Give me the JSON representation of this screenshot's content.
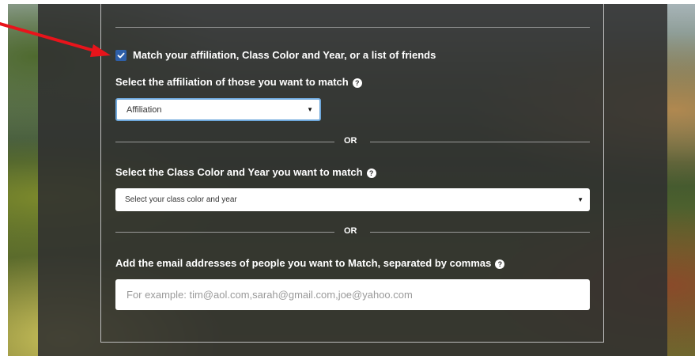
{
  "match_options": {
    "checkbox_label": "Match your affiliation, Class Color and Year, or a list of friends",
    "checked": true
  },
  "affiliation": {
    "question": "Select the affiliation of those you want to match",
    "select_value": "Affiliation"
  },
  "divider": {
    "or_label": "OR"
  },
  "class_color": {
    "question": "Select the Class Color and Year you want to match",
    "select_value": "Select your class color and year"
  },
  "emails": {
    "question": "Add the email addresses of people you want to Match, separated by commas",
    "placeholder": "For example: tim@aol.com,sarah@gmail.com,joe@yahoo.com"
  },
  "icons": {
    "help": "question-circle-icon",
    "checkbox": "check-icon",
    "dropdown": "caret-down-icon",
    "annotation": "red-arrow-icon"
  },
  "colors": {
    "checkbox": "#2e5fa8",
    "annotation_arrow": "#e8141b",
    "focus_border": "#6fa8dc"
  }
}
